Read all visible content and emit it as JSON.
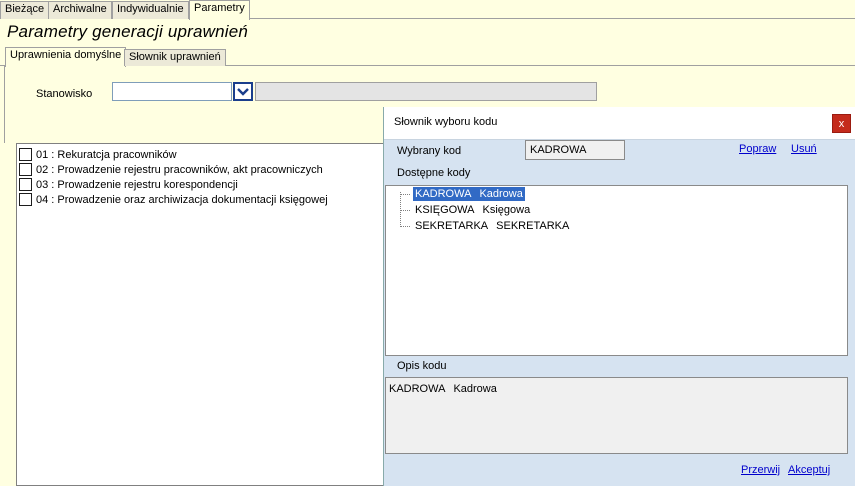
{
  "top_tabs": [
    "Bieżące",
    "Archiwalne",
    "Indywidualnie",
    "Parametry"
  ],
  "page_title": "Parametry generacji uprawnień",
  "sub_tabs": [
    "Uprawnienia domyślne",
    "Słownik uprawnień"
  ],
  "stanowisko": {
    "label": "Stanowisko",
    "value": ""
  },
  "permissions": [
    "01 : Rekuratcja pracowników",
    "02 : Prowadzenie rejestru pracowników, akt pracowniczych",
    "03 : Prowadzenie rejestru korespondencji",
    "04 : Prowadzenie oraz archiwizacja dokumentacji księgowej"
  ],
  "dialog": {
    "title": "Słownik wyboru kodu",
    "close": "x",
    "selected_label": "Wybrany kod",
    "selected_value": "KADROWA",
    "link_fix": "Popraw",
    "link_delete": "Usuń",
    "available_label": "Dostępne kody",
    "codes": [
      {
        "code": "KADROWA",
        "name": "Kadrowa"
      },
      {
        "code": "KSIĘGOWA",
        "name": "Księgowa"
      },
      {
        "code": "SEKRETARKA",
        "name": "SEKRETARKA"
      }
    ],
    "description_label": "Opis kodu",
    "description_code": "KADROWA",
    "description_name": "Kadrowa",
    "link_cancel": "Przerwij",
    "link_accept": "Akceptuj"
  },
  "colors": {
    "selection": "#316ac5",
    "dialog_bg": "#d6e3f1",
    "close": "#c42b1c",
    "link": "#0000cc"
  }
}
